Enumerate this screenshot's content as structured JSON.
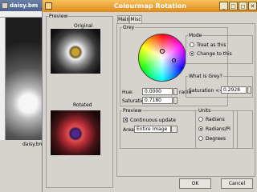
{
  "bg_window": {
    "title": "daisy.bm",
    "status": "daisy.bmp-"
  },
  "dialog": {
    "title": "Colourmap Rotation",
    "preview": {
      "label": "Preview",
      "original_label": "Original",
      "rotated_label": "Rotated"
    },
    "tabs": [
      {
        "label": "Main"
      },
      {
        "label": "Misc"
      }
    ],
    "grey": {
      "label": "Grey",
      "hue_label": "Hue:",
      "hue_value": "0.0000",
      "hue_unit": "radia",
      "saturation_label": "Saturation:",
      "saturation_value": "0.7180"
    },
    "mode": {
      "label": "Mode",
      "opt1": "Treat as this",
      "opt2": "Change to this"
    },
    "what_is_grey": {
      "label": "What is Grey?",
      "saturation_label": "Saturation <=",
      "saturation_value": "0.2928"
    },
    "preview_opts": {
      "label": "Preview",
      "continuous": "Continuous update",
      "area_label": "Area:",
      "area_value": "Entire Image"
    },
    "units": {
      "label": "Units",
      "opt1": "Radians",
      "opt2": "Radians/Pi",
      "opt3": "Degrees"
    },
    "ok": "OK",
    "cancel": "Cancel"
  },
  "icons": {
    "spin": "spin-arrows-icon",
    "dropdown": "chevron-down-icon",
    "close": "close-icon"
  }
}
